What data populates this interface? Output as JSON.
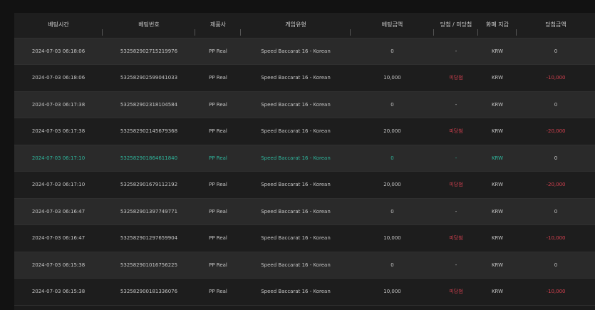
{
  "columns": [
    {
      "label": "베팅시간"
    },
    {
      "label": "베팅번호"
    },
    {
      "label": "제품사"
    },
    {
      "label": "게임유형"
    },
    {
      "label": "베팅금액"
    },
    {
      "label": "당첨 / 미당첨"
    },
    {
      "label": "화폐 지갑"
    },
    {
      "label": "당첨금액"
    }
  ],
  "rows": [
    {
      "time": "2024-07-03 06:18:06",
      "bet_no": "532582902715219976",
      "provider": "PP Real",
      "game": "Speed Baccarat 16 - Korean",
      "amount": "0",
      "result": "-",
      "currency": "KRW",
      "win": "0"
    },
    {
      "time": "2024-07-03 06:18:06",
      "bet_no": "532582902599041033",
      "provider": "PP Real",
      "game": "Speed Baccarat 16 - Korean",
      "amount": "10,000",
      "result": "미당첨",
      "currency": "KRW",
      "win": "-10,000"
    },
    {
      "time": "2024-07-03 06:17:38",
      "bet_no": "532582902318104584",
      "provider": "PP Real",
      "game": "Speed Baccarat 16 - Korean",
      "amount": "0",
      "result": "-",
      "currency": "KRW",
      "win": "0"
    },
    {
      "time": "2024-07-03 06:17:38",
      "bet_no": "532582902145679368",
      "provider": "PP Real",
      "game": "Speed Baccarat 16 - Korean",
      "amount": "20,000",
      "result": "미당첨",
      "currency": "KRW",
      "win": "-20,000"
    },
    {
      "time": "2024-07-03 06:17:10",
      "bet_no": "532582901864611840",
      "provider": "PP Real",
      "game": "Speed Baccarat 16 - Korean",
      "amount": "0",
      "result": "-",
      "currency": "KRW",
      "win": "0",
      "highlight": true
    },
    {
      "time": "2024-07-03 06:17:10",
      "bet_no": "532582901679112192",
      "provider": "PP Real",
      "game": "Speed Baccarat 16 - Korean",
      "amount": "20,000",
      "result": "미당첨",
      "currency": "KRW",
      "win": "-20,000"
    },
    {
      "time": "2024-07-03 06:16:47",
      "bet_no": "532582901397749771",
      "provider": "PP Real",
      "game": "Speed Baccarat 16 - Korean",
      "amount": "0",
      "result": "-",
      "currency": "KRW",
      "win": "0"
    },
    {
      "time": "2024-07-03 06:16:47",
      "bet_no": "532582901297659904",
      "provider": "PP Real",
      "game": "Speed Baccarat 16 - Korean",
      "amount": "10,000",
      "result": "미당첨",
      "currency": "KRW",
      "win": "-10,000"
    },
    {
      "time": "2024-07-03 06:15:38",
      "bet_no": "532582901016756225",
      "provider": "PP Real",
      "game": "Speed Baccarat 16 - Korean",
      "amount": "0",
      "result": "-",
      "currency": "KRW",
      "win": "0"
    },
    {
      "time": "2024-07-03 06:15:38",
      "bet_no": "532582900181336076",
      "provider": "PP Real",
      "game": "Speed Baccarat 16 - Korean",
      "amount": "10,000",
      "result": "미당첨",
      "currency": "KRW",
      "win": "-10,000"
    }
  ],
  "colors": {
    "background": "#121212",
    "row_odd": "#2a2a2a",
    "row_even": "#1d1d1d",
    "loss_red": "#d3404f",
    "highlight_teal": "#2fb59c"
  }
}
